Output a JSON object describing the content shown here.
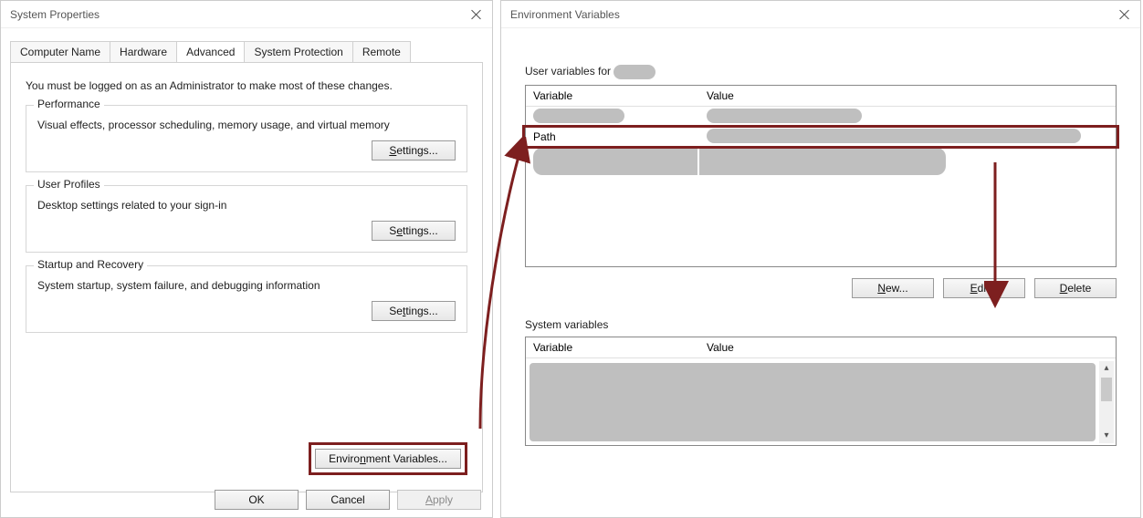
{
  "sysprop": {
    "title": "System Properties",
    "tabs": {
      "computer_name": "Computer Name",
      "hardware": "Hardware",
      "advanced": "Advanced",
      "system_protection": "System Protection",
      "remote": "Remote"
    },
    "intro": "You must be logged on as an Administrator to make most of these changes.",
    "performance": {
      "legend": "Performance",
      "desc": "Visual effects, processor scheduling, memory usage, and virtual memory",
      "settings": "Settings..."
    },
    "user_profiles": {
      "legend": "User Profiles",
      "desc": "Desktop settings related to your sign-in",
      "settings": "Settings..."
    },
    "startup": {
      "legend": "Startup and Recovery",
      "desc": "System startup, system failure, and debugging information",
      "settings": "Settings..."
    },
    "env_button": "Environment Variables...",
    "ok": "OK",
    "cancel": "Cancel",
    "apply": "Apply"
  },
  "env": {
    "title": "Environment Variables",
    "user_section_prefix": "User variables for",
    "columns": {
      "variable": "Variable",
      "value": "Value"
    },
    "path_label": "Path",
    "buttons": {
      "new": "New...",
      "edit": "Edit...",
      "delete": "Delete"
    },
    "system_section": "System variables"
  }
}
